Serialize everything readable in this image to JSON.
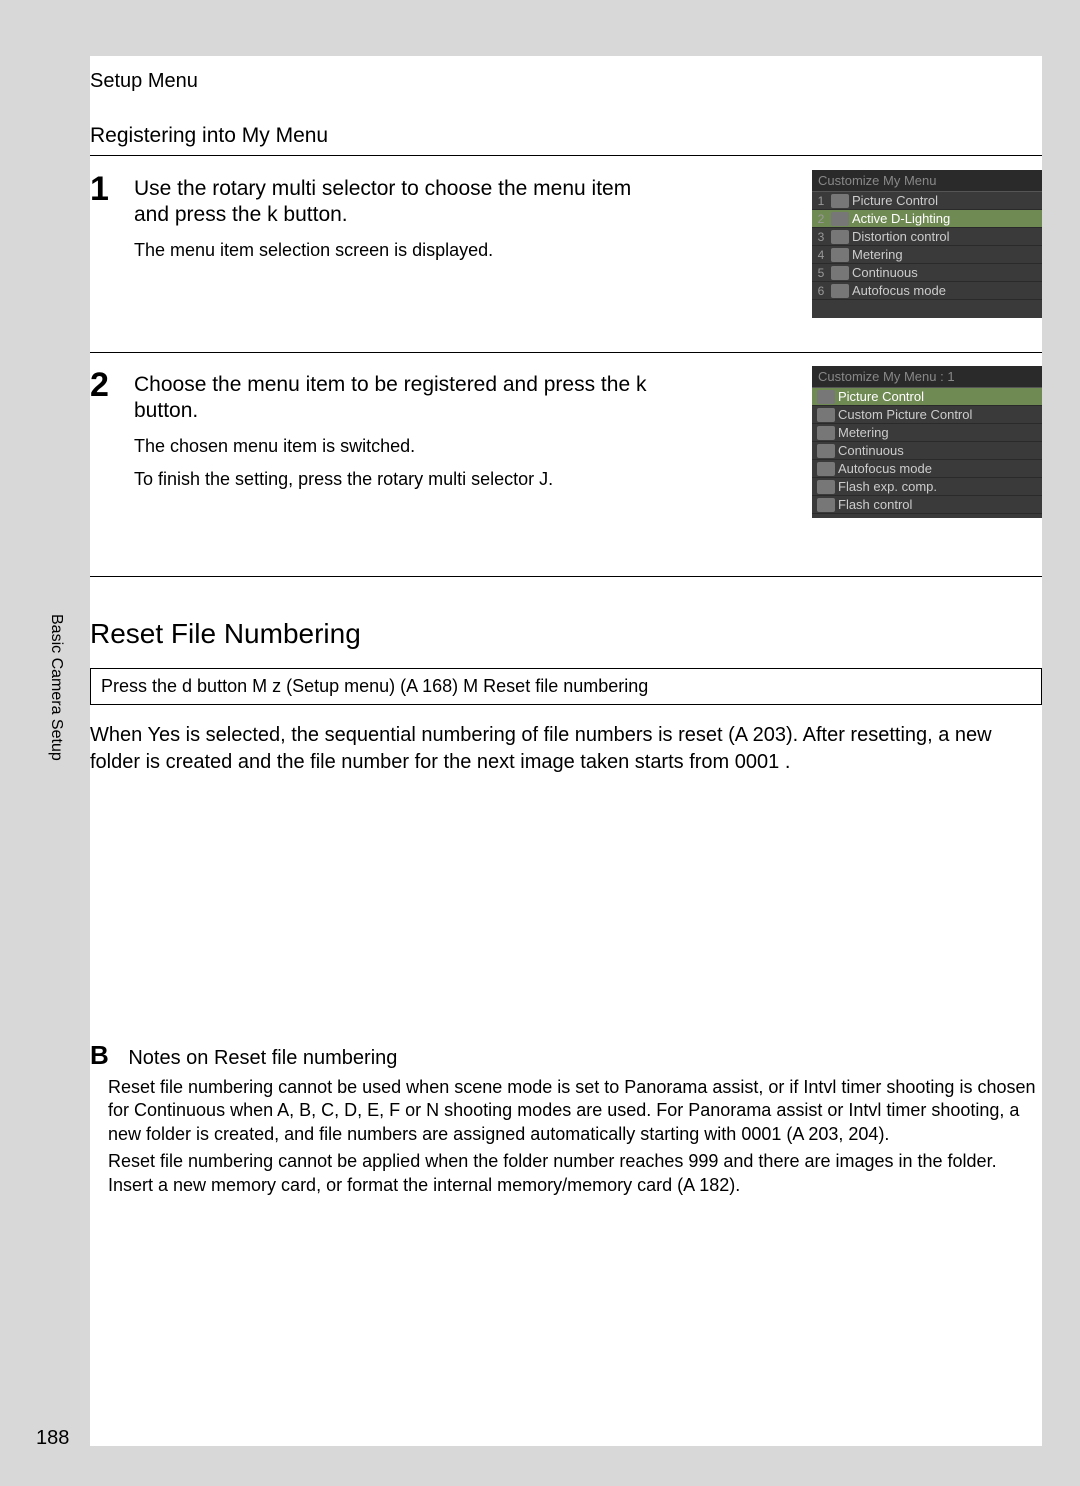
{
  "breadcrumb": "Setup Menu",
  "subtitle": "Registering into My Menu",
  "steps": {
    "s1": {
      "num": "1",
      "main": "Use the rotary multi selector to choose the menu item and press the k button.",
      "sub": "The menu item selection screen is displayed."
    },
    "s2": {
      "num": "2",
      "main": "Choose the menu item to be registered and press the k button.",
      "sub1": "The chosen menu item is switched.",
      "sub2": "To finish the setting, press the rotary multi selector J."
    }
  },
  "screen1": {
    "title": "Customize My Menu",
    "rows": [
      {
        "n": "1",
        "label": "Picture Control"
      },
      {
        "n": "2",
        "label": "Active D-Lighting"
      },
      {
        "n": "3",
        "label": "Distortion control"
      },
      {
        "n": "4",
        "label": "Metering"
      },
      {
        "n": "5",
        "label": "Continuous"
      },
      {
        "n": "6",
        "label": "Autofocus mode"
      }
    ],
    "selected_index": 1
  },
  "screen2": {
    "title": "Customize My Menu : 1",
    "rows": [
      {
        "label": "Picture Control"
      },
      {
        "label": "Custom Picture Control"
      },
      {
        "label": "Metering"
      },
      {
        "label": "Continuous"
      },
      {
        "label": "Autofocus mode"
      },
      {
        "label": "Flash exp. comp."
      },
      {
        "label": "Flash control"
      }
    ],
    "selected_index": 0
  },
  "section2_title": "Reset File Numbering",
  "pathbox": "Press the d button M z (Setup menu) (A 168) M Reset file numbering",
  "para1": "When Yes is selected, the sequential numbering of file numbers is reset (A 203). After resetting, a new folder is created and the file number for the next image taken starts from  0001 .",
  "sidetab": "Basic Camera Setup",
  "notes": {
    "marker": "B",
    "title": "Notes on Reset file numbering",
    "body1": "Reset file numbering cannot be used when scene mode is set to Panorama assist, or if Intvl timer shooting is chosen for Continuous when A, B, C, D, E, F or N shooting modes are used. For Panorama assist or Intvl timer shooting, a new folder is created, and file numbers are assigned automatically starting with  0001  (A 203, 204).",
    "body2": "Reset file numbering cannot be applied when the folder number reaches 999 and there are images in the folder. Insert a new memory card, or format the internal memory/memory card (A 182)."
  },
  "page_number": "188"
}
